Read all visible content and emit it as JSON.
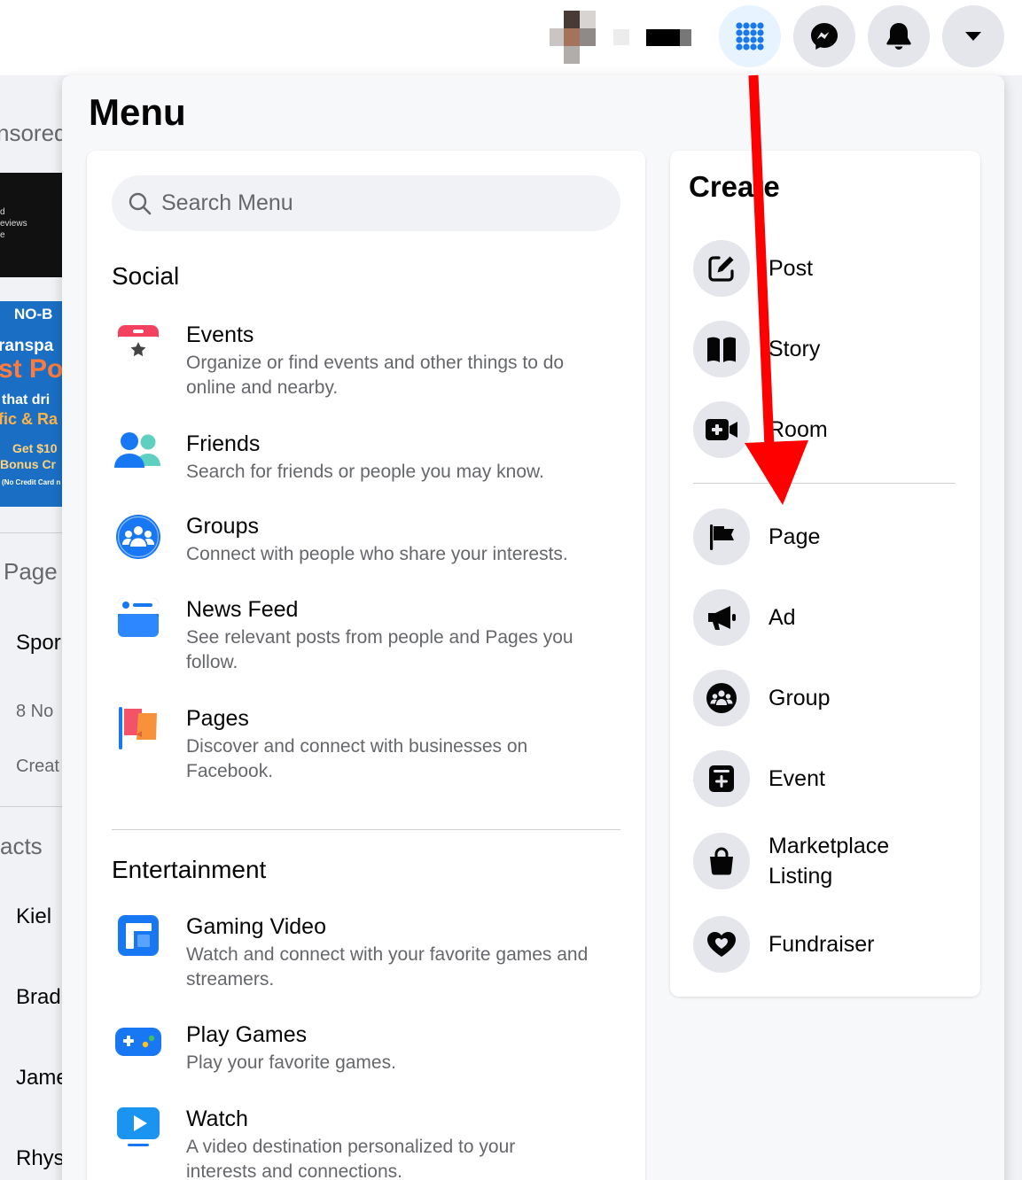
{
  "colors": {
    "accent": "#1877f2",
    "annotation_arrow": "#ff0000",
    "page_bg": "#f0f2f5",
    "icon_bg": "#e4e6eb"
  },
  "topbar": {
    "icons": [
      "menu-grid-icon",
      "messenger-icon",
      "notifications-bell-icon",
      "account-dropdown-icon"
    ]
  },
  "background_left": {
    "sponsored": "nsored",
    "ad1_lines": [
      "d",
      "eviews",
      "e"
    ],
    "ad2_lines": [
      "NO-B",
      "ranspa",
      "st Po",
      "that dri",
      "fic & Ra",
      "Get $10",
      "Bonus Cr",
      "(No Credit Card n"
    ],
    "pages_heading": "Page",
    "page_name": "Spor",
    "notifications": "8 No",
    "create": "Creat",
    "contacts_heading": "acts",
    "contacts": [
      "Kiel",
      "Brad",
      "Jame",
      "Rhys"
    ]
  },
  "menu": {
    "title": "Menu",
    "search": {
      "placeholder": "Search Menu"
    },
    "sections": [
      {
        "title": "Social",
        "items": [
          {
            "title": "Events",
            "desc": "Organize or find events and other things to do online and nearby.",
            "icon": "events-calendar-icon"
          },
          {
            "title": "Friends",
            "desc": "Search for friends or people you may know.",
            "icon": "friends-icon"
          },
          {
            "title": "Groups",
            "desc": "Connect with people who share your interests.",
            "icon": "groups-icon"
          },
          {
            "title": "News Feed",
            "desc": "See relevant posts from people and Pages you follow.",
            "icon": "news-feed-icon"
          },
          {
            "title": "Pages",
            "desc": "Discover and connect with businesses on Facebook.",
            "icon": "pages-flag-icon"
          }
        ]
      },
      {
        "title": "Entertainment",
        "items": [
          {
            "title": "Gaming Video",
            "desc": "Watch and connect with your favorite games and streamers.",
            "icon": "gaming-video-icon"
          },
          {
            "title": "Play Games",
            "desc": "Play your favorite games.",
            "icon": "play-games-controller-icon"
          },
          {
            "title": "Watch",
            "desc": "A video destination personalized to your interests and connections.",
            "icon": "watch-play-icon"
          }
        ]
      }
    ]
  },
  "create": {
    "title": "Create",
    "items": [
      {
        "label": "Post",
        "icon": "edit-post-icon"
      },
      {
        "label": "Story",
        "icon": "story-book-icon"
      },
      {
        "label": "Room",
        "icon": "video-room-icon"
      },
      {
        "label": "Page",
        "icon": "page-flag-icon"
      },
      {
        "label": "Ad",
        "icon": "ad-megaphone-icon"
      },
      {
        "label": "Group",
        "icon": "group-icon"
      },
      {
        "label": "Event",
        "icon": "event-plus-icon"
      },
      {
        "label": "Marketplace Listing",
        "icon": "marketplace-bag-icon"
      },
      {
        "label": "Fundraiser",
        "icon": "fundraiser-heart-icon"
      }
    ]
  }
}
